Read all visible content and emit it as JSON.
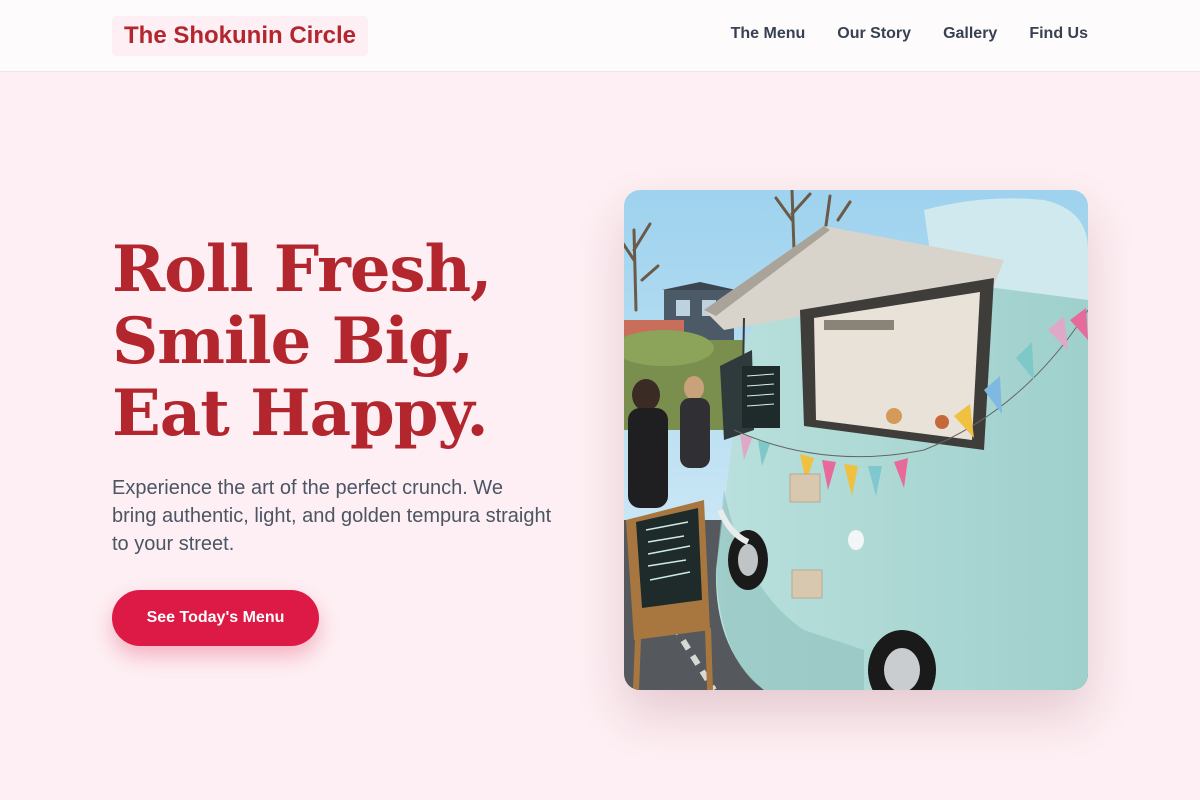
{
  "brand": {
    "name": "The Shokunin Circle"
  },
  "nav": {
    "items": [
      {
        "label": "The Menu"
      },
      {
        "label": "Our Story"
      },
      {
        "label": "Gallery"
      },
      {
        "label": "Find Us"
      }
    ]
  },
  "hero": {
    "headline": [
      "Roll Fresh,",
      "Smile Big,",
      "Eat Happy."
    ],
    "subtext": "Experience the art of the perfect crunch. We bring authentic, light, and golden tempura straight to your street.",
    "cta_label": "See Today's Menu"
  },
  "colors": {
    "accent": "#b3262d",
    "button": "#dc1a45",
    "background": "#fdeff3"
  }
}
